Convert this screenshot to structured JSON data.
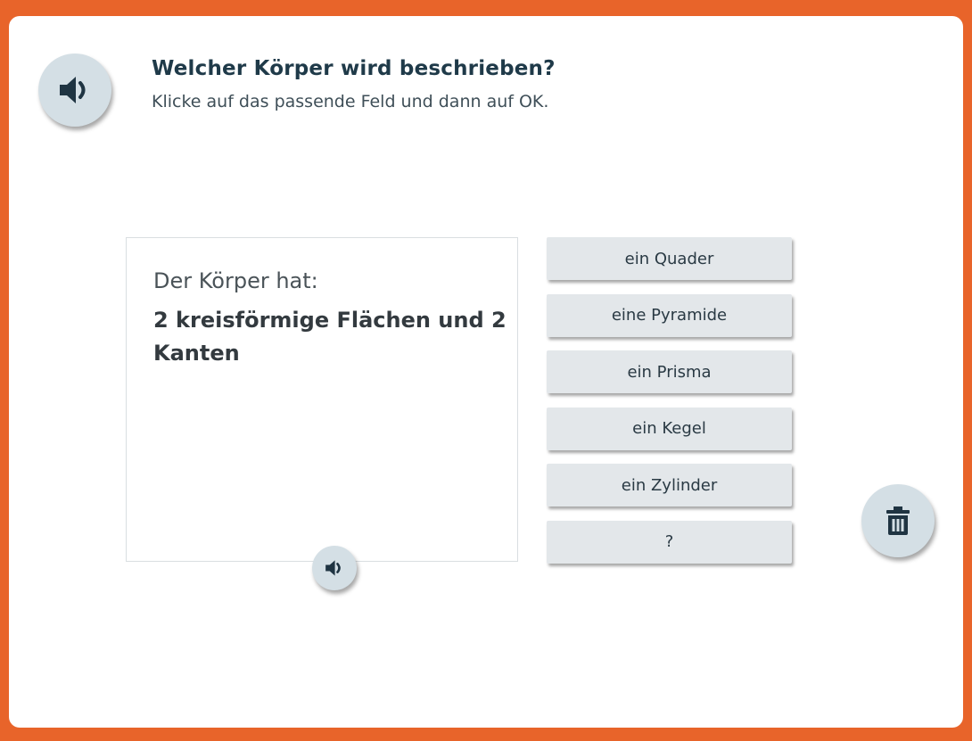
{
  "header": {
    "title": "Welcher Körper wird beschrieben?",
    "instruction": "Klicke auf das passende Feld und dann auf OK."
  },
  "description": {
    "intro": "Der Körper hat:",
    "text": "2 kreisförmige Flächen und 2 Kanten"
  },
  "options": [
    {
      "label": "ein Quader"
    },
    {
      "label": "eine Pyramide"
    },
    {
      "label": "ein Prisma"
    },
    {
      "label": "ein Kegel"
    },
    {
      "label": "ein Zylinder"
    },
    {
      "label": "?"
    }
  ],
  "icons": {
    "main_audio": "speaker-icon",
    "description_audio": "speaker-icon",
    "delete": "trash-icon"
  },
  "colors": {
    "frame": "#e8642a",
    "button_bg": "#d4dfe5",
    "icon": "#1f3442",
    "option_bg": "#e3e7ea"
  }
}
